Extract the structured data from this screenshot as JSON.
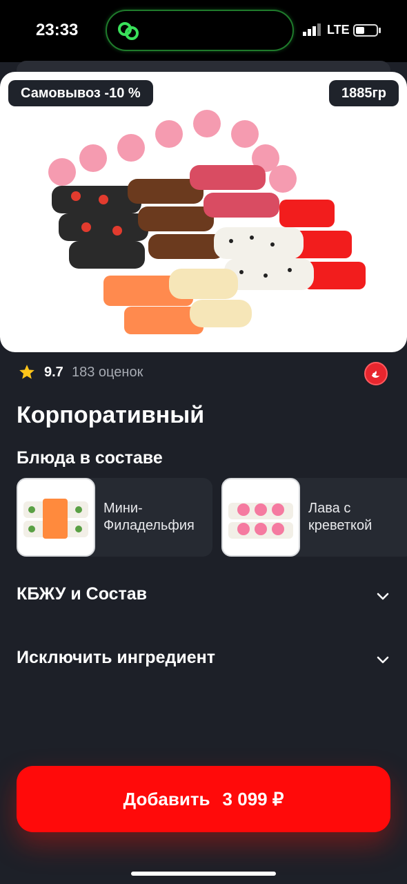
{
  "status_bar": {
    "time": "23:33",
    "network": "LTE"
  },
  "hero": {
    "discount_badge": "Самовывоз -10 %",
    "weight_badge": "1885гр"
  },
  "rating": {
    "value": "9.7",
    "count_text": "183 оценок"
  },
  "product": {
    "title": "Корпоративный"
  },
  "composition": {
    "title": "Блюда в составе",
    "items": [
      {
        "label": "Мини-Филадельфия"
      },
      {
        "label": "Лава с креветкой"
      }
    ]
  },
  "sections": {
    "nutrition": "КБЖУ и Состав",
    "exclude": "Исключить ингредиент"
  },
  "add_button": {
    "label": "Добавить",
    "price": "3 099 ₽"
  },
  "colors": {
    "background": "#1d2028",
    "accent": "#ff0a0a",
    "badge": "#1f232b"
  },
  "icons": [
    "app-link-icon",
    "signal-icon",
    "battery-icon",
    "star-icon",
    "spicy-icon",
    "chevron-down-icon"
  ]
}
